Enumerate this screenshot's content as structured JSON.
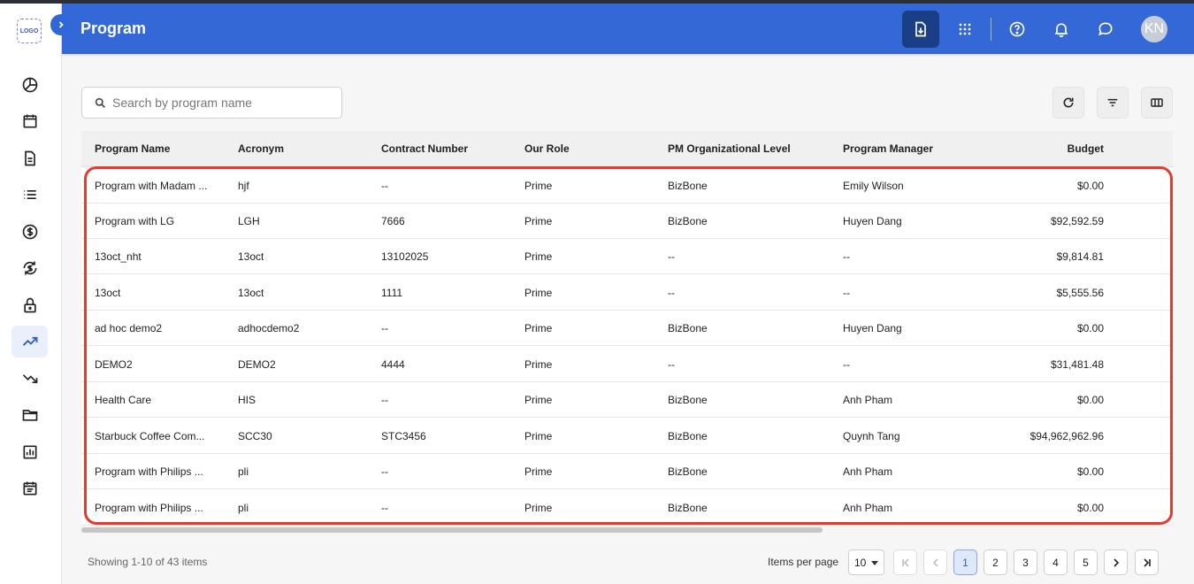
{
  "app": {
    "logo_text": "LOGO",
    "title": "Program",
    "user_initials": "KN",
    "colors": {
      "header": "#3468d6",
      "active_header_button": "#1b3f86",
      "highlight_border": "#e53a2f",
      "active_page": "#dfe8f8"
    }
  },
  "sidebar": {
    "items": [
      {
        "icon": "pie-chart-icon"
      },
      {
        "icon": "calendar-icon"
      },
      {
        "icon": "document-icon"
      },
      {
        "icon": "list-icon"
      },
      {
        "icon": "dollar-icon"
      },
      {
        "icon": "dollar-exchange-icon"
      },
      {
        "icon": "lock-icon"
      },
      {
        "icon": "trending-up-icon",
        "active": true
      },
      {
        "icon": "trending-down-icon"
      },
      {
        "icon": "folder-icon"
      },
      {
        "icon": "bar-report-icon"
      },
      {
        "icon": "schedule-icon"
      }
    ]
  },
  "header": {
    "buttons": [
      "export-icon",
      "apps-grid-icon",
      "help-icon",
      "bell-icon",
      "chat-icon"
    ]
  },
  "search": {
    "placeholder": "Search by program name",
    "value": ""
  },
  "toolbar": {
    "buttons": [
      "refresh-icon",
      "filter-icon",
      "columns-icon"
    ]
  },
  "table": {
    "columns": [
      "Program Name",
      "Acronym",
      "Contract Number",
      "Our Role",
      "PM Organizational Level",
      "Program Manager",
      "Budget"
    ],
    "rows": [
      [
        "Program with Madam ...",
        "hjf",
        "--",
        "Prime",
        "BizBone",
        "Emily Wilson",
        "$0.00"
      ],
      [
        "Program with LG",
        "LGH",
        "7666",
        "Prime",
        "BizBone",
        "Huyen Dang",
        "$92,592.59"
      ],
      [
        "13oct_nht",
        "13oct",
        "13102025",
        "Prime",
        "--",
        "--",
        "$9,814.81"
      ],
      [
        "13oct",
        "13oct",
        "1111",
        "Prime",
        "--",
        "--",
        "$5,555.56"
      ],
      [
        "ad hoc demo2",
        "adhocdemo2",
        "--",
        "Prime",
        "BizBone",
        "Huyen Dang",
        "$0.00"
      ],
      [
        "DEMO2",
        "DEMO2",
        "4444",
        "Prime",
        "--",
        "--",
        "$31,481.48"
      ],
      [
        "Health Care",
        "HIS",
        "--",
        "Prime",
        "BizBone",
        "Anh Pham",
        "$0.00"
      ],
      [
        "Starbuck Coffee Com...",
        "SCC30",
        "STC3456",
        "Prime",
        "BizBone",
        "Quynh Tang",
        "$94,962,962.96"
      ],
      [
        "Program with Philips ...",
        "pli",
        "--",
        "Prime",
        "BizBone",
        "Anh Pham",
        "$0.00"
      ],
      [
        "Program with Philips ...",
        "pli",
        "--",
        "Prime",
        "BizBone",
        "Anh Pham",
        "$0.00"
      ]
    ]
  },
  "pagination": {
    "showing_text": "Showing 1-10 of 43 items",
    "items_per_page_label": "Items per page",
    "items_per_page_value": "10",
    "pages": [
      "1",
      "2",
      "3",
      "4",
      "5"
    ],
    "current_page": "1"
  }
}
